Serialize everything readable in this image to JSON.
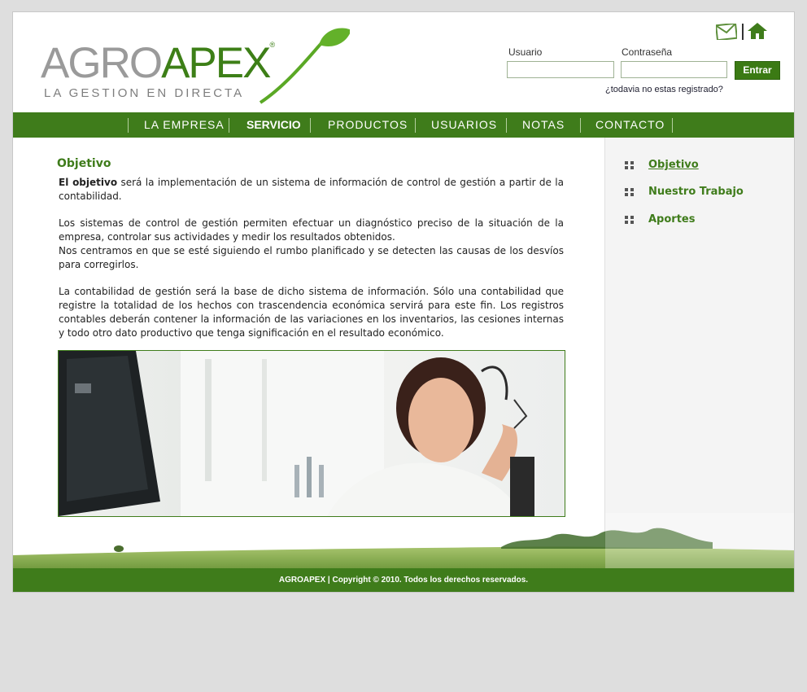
{
  "brand": {
    "logo_part1": "AGRO",
    "logo_part2": "APEX",
    "logo_reg": "®",
    "tagline": "LA GESTION EN DIRECTA",
    "primary_color": "#3f7c1b"
  },
  "header": {
    "icons": [
      "mail-icon",
      "home-icon"
    ],
    "user_label": "Usuario",
    "user_value": "",
    "password_label": "Contraseña",
    "password_value": "",
    "login_button": "Entrar",
    "register_link": "¿todavia no estas registrado?"
  },
  "nav": {
    "items": [
      {
        "label": "LA EMPRESA"
      },
      {
        "label": "SERVICIO"
      },
      {
        "label": "PRODUCTOS"
      },
      {
        "label": "USUARIOS"
      },
      {
        "label": "NOTAS"
      },
      {
        "label": "CONTACTO"
      }
    ],
    "active": "SERVICIO"
  },
  "main": {
    "title": "Objetivo",
    "p1_bold": "El objetivo",
    "p1_rest": " será la implementación de un sistema de información de control de gestión a partir de la contabilidad.",
    "p2": "Los sistemas de control de gestión permiten efectuar un diagnóstico preciso de la situación de la empresa, controlar sus actividades y medir los resultados obtenidos.",
    "p3": "Nos centramos en que se esté siguiendo el rumbo planificado y se detecten las causas de los desvíos para corregirlos.",
    "p4": "La contabilidad de gestión será  la base de dicho sistema de información. Sólo una contabilidad que registre la totalidad de los hechos con trascendencia económica servirá para este fin. Los registros contables deberán contener la información de las variaciones en los inventarios, las cesiones internas y todo otro dato productivo que tenga significación en el resultado económico."
  },
  "sidebar": {
    "items": [
      {
        "label": "Objetivo"
      },
      {
        "label": "Nuestro Trabajo"
      },
      {
        "label": "Aportes"
      }
    ],
    "active": "Objetivo"
  },
  "footer": {
    "text": "AGROAPEX | Copyright © 2010. Todos los derechos reservados."
  }
}
